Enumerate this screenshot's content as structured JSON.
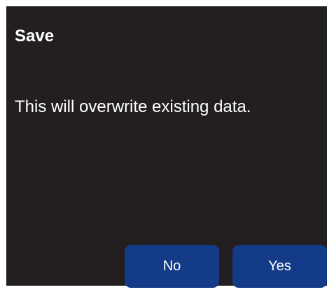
{
  "dialog": {
    "title": "Save",
    "message": "This will overwrite existing data.",
    "buttons": {
      "no_label": "No",
      "yes_label": "Yes"
    },
    "colors": {
      "background": "#231f20",
      "button": "#143b87",
      "text": "#ffffff"
    }
  }
}
